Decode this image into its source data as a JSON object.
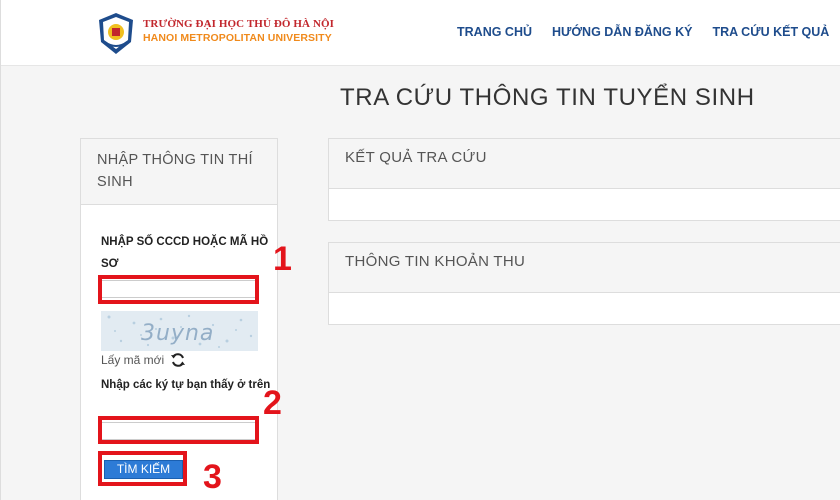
{
  "header": {
    "brand_name": "TRƯỜNG ĐẠI HỌC THỦ ĐÔ HÀ NỘI",
    "brand_sub": "HANOI METROPOLITAN UNIVERSITY",
    "nav": [
      {
        "label": "TRANG CHỦ"
      },
      {
        "label": "HƯỚNG DẪN ĐĂNG KÝ"
      },
      {
        "label": "TRA CỨU KẾT QUẢ"
      }
    ]
  },
  "page_title": "TRA CỨU THÔNG TIN TUYỂN SINH",
  "form": {
    "heading": "NHẬP THÔNG TIN THÍ SINH",
    "id_label": "NHẬP SỐ CCCD HOẶC MÃ HỒ SƠ",
    "id_value": "",
    "captcha_text": "3uyna",
    "refresh_label": "Lấy mã mới",
    "captcha_label": "Nhập các ký tự bạn thấy ở trên",
    "captcha_value": "",
    "search_label": "TÌM KIẾM"
  },
  "results": {
    "result_heading": "KẾT QUẢ TRA CỨU",
    "fee_heading": "THÔNG TIN KHOẢN THU"
  },
  "annotations": {
    "step1": "1",
    "step2": "2",
    "step3": "3",
    "color": "#e3141b"
  }
}
